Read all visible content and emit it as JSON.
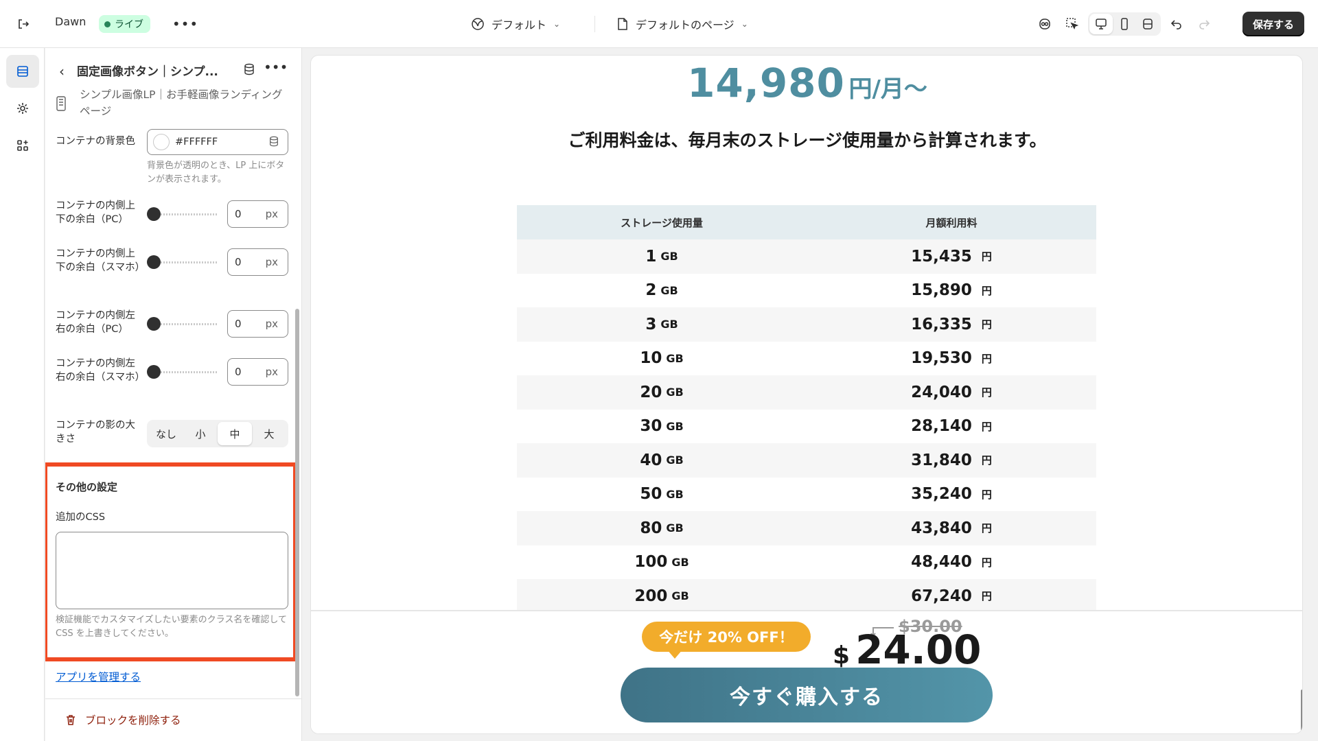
{
  "topbar": {
    "store_name": "Dawn",
    "status_badge": "ライブ",
    "theme_selector": "デフォルト",
    "page_selector": "デフォルトのページ",
    "save_label": "保存する",
    "status_color": "#29845a"
  },
  "panel": {
    "block_title": "固定画像ボタン｜シンプ...",
    "template_name": "シンプル画像LP｜お手軽画像ランディングページ",
    "bg_color_label": "コンテナの背景色",
    "bg_color_value": "#FFFFFF",
    "bg_color_hint": "背景色が透明のとき、LP 上にボタンが表示されます。",
    "padding_rows": [
      {
        "label": "コンテナの内側上下の余白（PC）",
        "value": "0",
        "unit": "px"
      },
      {
        "label": "コンテナの内側上下の余白（スマホ）",
        "value": "0",
        "unit": "px"
      },
      {
        "label": "コンテナの内側左右の余白（PC）",
        "value": "0",
        "unit": "px"
      },
      {
        "label": "コンテナの内側左右の余白（スマホ）",
        "value": "0",
        "unit": "px"
      }
    ],
    "shadow_label": "コンテナの影の大きさ",
    "shadow_options": [
      "なし",
      "小",
      "中",
      "大"
    ],
    "shadow_selected": "中",
    "other_settings_title": "その他の設定",
    "css_label": "追加のCSS",
    "css_value": "",
    "css_hint": "検証機能でカスタマイズしたい要素のクラス名を確認して CSS を上書きしてください。",
    "manage_apps_link": "アプリを管理する",
    "delete_block_label": "ブロックを削除する"
  },
  "preview": {
    "headline_price": "14,980",
    "headline_unit": "円/月〜",
    "notice": "ご利用料金は、毎月末のストレージ使用量から計算されます。",
    "table_headers": [
      "ストレージ使用量",
      "月額利用料"
    ],
    "table_rows": [
      {
        "storage": "1",
        "storage_unit": "GB",
        "fee": "15,435",
        "fee_unit": "円"
      },
      {
        "storage": "2",
        "storage_unit": "GB",
        "fee": "15,890",
        "fee_unit": "円"
      },
      {
        "storage": "3",
        "storage_unit": "GB",
        "fee": "16,335",
        "fee_unit": "円"
      },
      {
        "storage": "10",
        "storage_unit": "GB",
        "fee": "19,530",
        "fee_unit": "円"
      },
      {
        "storage": "20",
        "storage_unit": "GB",
        "fee": "24,040",
        "fee_unit": "円"
      },
      {
        "storage": "30",
        "storage_unit": "GB",
        "fee": "28,140",
        "fee_unit": "円"
      },
      {
        "storage": "40",
        "storage_unit": "GB",
        "fee": "31,840",
        "fee_unit": "円"
      },
      {
        "storage": "50",
        "storage_unit": "GB",
        "fee": "35,240",
        "fee_unit": "円"
      },
      {
        "storage": "80",
        "storage_unit": "GB",
        "fee": "43,840",
        "fee_unit": "円"
      },
      {
        "storage": "100",
        "storage_unit": "GB",
        "fee": "48,440",
        "fee_unit": "円"
      },
      {
        "storage": "200",
        "storage_unit": "GB",
        "fee": "67,240",
        "fee_unit": "円"
      }
    ],
    "offer_badge": "今だけ 20% OFF！",
    "old_price": "$30.00",
    "currency": "$",
    "new_price": "24.00",
    "buy_button": "今すぐ購入する",
    "accent_color": "#4f8ea0",
    "offer_color": "#f2ac2b",
    "highlight_color": "#f04a23"
  }
}
